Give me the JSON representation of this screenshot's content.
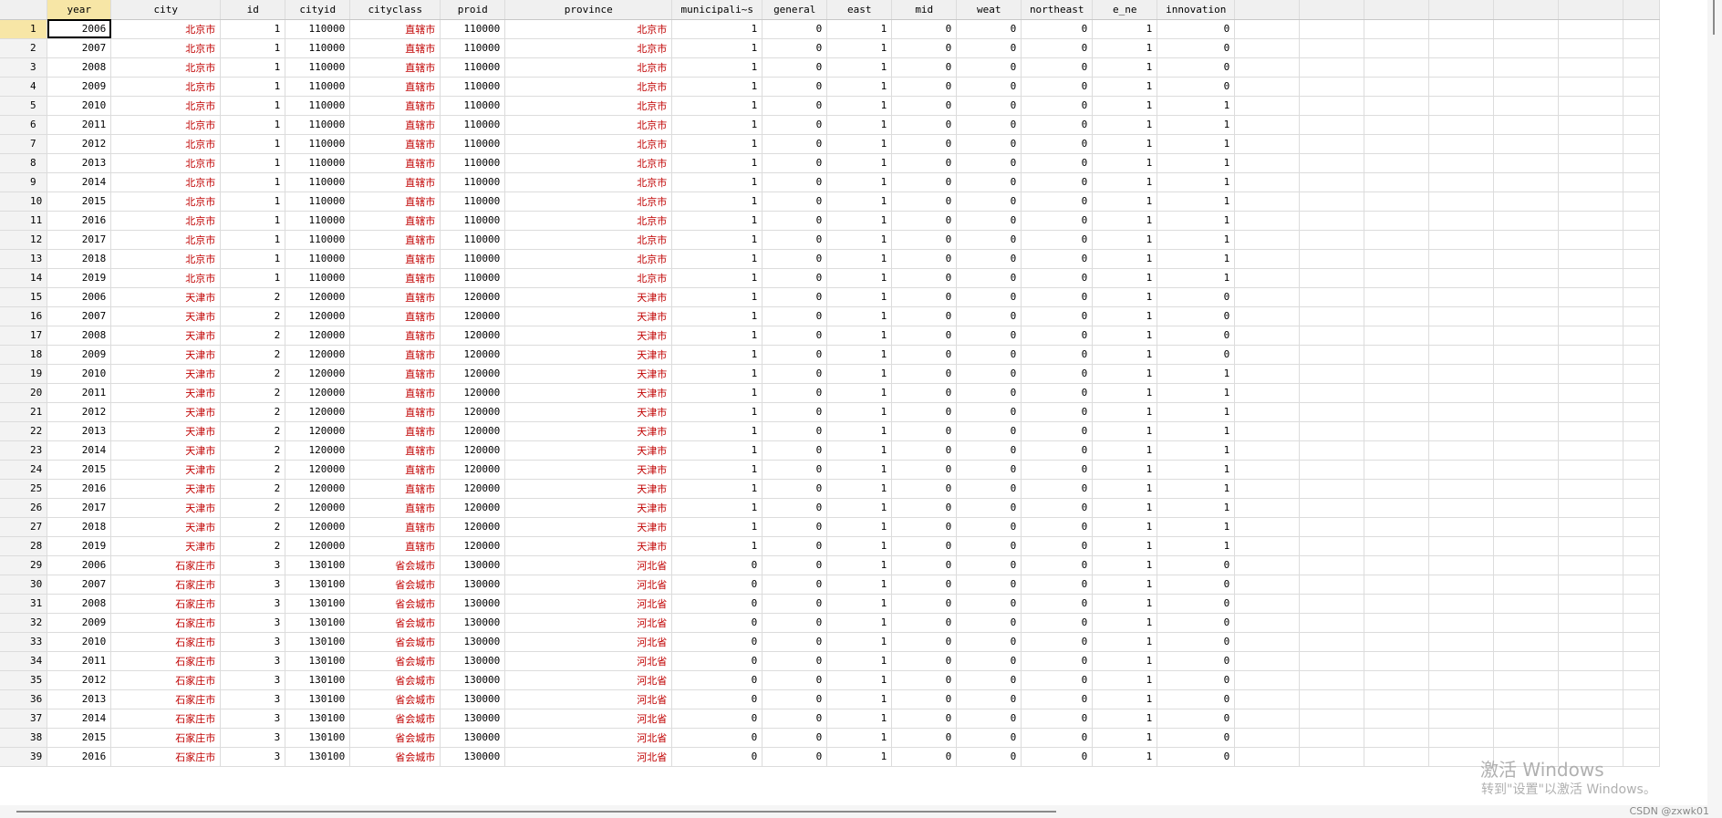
{
  "columns": [
    "year",
    "city",
    "id",
    "cityid",
    "cityclass",
    "proid",
    "province",
    "municipali~s",
    "general",
    "east",
    "mid",
    "weat",
    "northeast",
    "e_ne",
    "innovation"
  ],
  "column_types": [
    "num",
    "str",
    "num",
    "num",
    "str",
    "num",
    "str",
    "num",
    "num",
    "num",
    "num",
    "num",
    "num",
    "num",
    "num"
  ],
  "rows": [
    [
      "2006",
      "北京市",
      "1",
      "110000",
      "直辖市",
      "110000",
      "北京市",
      "1",
      "0",
      "1",
      "0",
      "0",
      "0",
      "1",
      "0"
    ],
    [
      "2007",
      "北京市",
      "1",
      "110000",
      "直辖市",
      "110000",
      "北京市",
      "1",
      "0",
      "1",
      "0",
      "0",
      "0",
      "1",
      "0"
    ],
    [
      "2008",
      "北京市",
      "1",
      "110000",
      "直辖市",
      "110000",
      "北京市",
      "1",
      "0",
      "1",
      "0",
      "0",
      "0",
      "1",
      "0"
    ],
    [
      "2009",
      "北京市",
      "1",
      "110000",
      "直辖市",
      "110000",
      "北京市",
      "1",
      "0",
      "1",
      "0",
      "0",
      "0",
      "1",
      "0"
    ],
    [
      "2010",
      "北京市",
      "1",
      "110000",
      "直辖市",
      "110000",
      "北京市",
      "1",
      "0",
      "1",
      "0",
      "0",
      "0",
      "1",
      "1"
    ],
    [
      "2011",
      "北京市",
      "1",
      "110000",
      "直辖市",
      "110000",
      "北京市",
      "1",
      "0",
      "1",
      "0",
      "0",
      "0",
      "1",
      "1"
    ],
    [
      "2012",
      "北京市",
      "1",
      "110000",
      "直辖市",
      "110000",
      "北京市",
      "1",
      "0",
      "1",
      "0",
      "0",
      "0",
      "1",
      "1"
    ],
    [
      "2013",
      "北京市",
      "1",
      "110000",
      "直辖市",
      "110000",
      "北京市",
      "1",
      "0",
      "1",
      "0",
      "0",
      "0",
      "1",
      "1"
    ],
    [
      "2014",
      "北京市",
      "1",
      "110000",
      "直辖市",
      "110000",
      "北京市",
      "1",
      "0",
      "1",
      "0",
      "0",
      "0",
      "1",
      "1"
    ],
    [
      "2015",
      "北京市",
      "1",
      "110000",
      "直辖市",
      "110000",
      "北京市",
      "1",
      "0",
      "1",
      "0",
      "0",
      "0",
      "1",
      "1"
    ],
    [
      "2016",
      "北京市",
      "1",
      "110000",
      "直辖市",
      "110000",
      "北京市",
      "1",
      "0",
      "1",
      "0",
      "0",
      "0",
      "1",
      "1"
    ],
    [
      "2017",
      "北京市",
      "1",
      "110000",
      "直辖市",
      "110000",
      "北京市",
      "1",
      "0",
      "1",
      "0",
      "0",
      "0",
      "1",
      "1"
    ],
    [
      "2018",
      "北京市",
      "1",
      "110000",
      "直辖市",
      "110000",
      "北京市",
      "1",
      "0",
      "1",
      "0",
      "0",
      "0",
      "1",
      "1"
    ],
    [
      "2019",
      "北京市",
      "1",
      "110000",
      "直辖市",
      "110000",
      "北京市",
      "1",
      "0",
      "1",
      "0",
      "0",
      "0",
      "1",
      "1"
    ],
    [
      "2006",
      "天津市",
      "2",
      "120000",
      "直辖市",
      "120000",
      "天津市",
      "1",
      "0",
      "1",
      "0",
      "0",
      "0",
      "1",
      "0"
    ],
    [
      "2007",
      "天津市",
      "2",
      "120000",
      "直辖市",
      "120000",
      "天津市",
      "1",
      "0",
      "1",
      "0",
      "0",
      "0",
      "1",
      "0"
    ],
    [
      "2008",
      "天津市",
      "2",
      "120000",
      "直辖市",
      "120000",
      "天津市",
      "1",
      "0",
      "1",
      "0",
      "0",
      "0",
      "1",
      "0"
    ],
    [
      "2009",
      "天津市",
      "2",
      "120000",
      "直辖市",
      "120000",
      "天津市",
      "1",
      "0",
      "1",
      "0",
      "0",
      "0",
      "1",
      "0"
    ],
    [
      "2010",
      "天津市",
      "2",
      "120000",
      "直辖市",
      "120000",
      "天津市",
      "1",
      "0",
      "1",
      "0",
      "0",
      "0",
      "1",
      "1"
    ],
    [
      "2011",
      "天津市",
      "2",
      "120000",
      "直辖市",
      "120000",
      "天津市",
      "1",
      "0",
      "1",
      "0",
      "0",
      "0",
      "1",
      "1"
    ],
    [
      "2012",
      "天津市",
      "2",
      "120000",
      "直辖市",
      "120000",
      "天津市",
      "1",
      "0",
      "1",
      "0",
      "0",
      "0",
      "1",
      "1"
    ],
    [
      "2013",
      "天津市",
      "2",
      "120000",
      "直辖市",
      "120000",
      "天津市",
      "1",
      "0",
      "1",
      "0",
      "0",
      "0",
      "1",
      "1"
    ],
    [
      "2014",
      "天津市",
      "2",
      "120000",
      "直辖市",
      "120000",
      "天津市",
      "1",
      "0",
      "1",
      "0",
      "0",
      "0",
      "1",
      "1"
    ],
    [
      "2015",
      "天津市",
      "2",
      "120000",
      "直辖市",
      "120000",
      "天津市",
      "1",
      "0",
      "1",
      "0",
      "0",
      "0",
      "1",
      "1"
    ],
    [
      "2016",
      "天津市",
      "2",
      "120000",
      "直辖市",
      "120000",
      "天津市",
      "1",
      "0",
      "1",
      "0",
      "0",
      "0",
      "1",
      "1"
    ],
    [
      "2017",
      "天津市",
      "2",
      "120000",
      "直辖市",
      "120000",
      "天津市",
      "1",
      "0",
      "1",
      "0",
      "0",
      "0",
      "1",
      "1"
    ],
    [
      "2018",
      "天津市",
      "2",
      "120000",
      "直辖市",
      "120000",
      "天津市",
      "1",
      "0",
      "1",
      "0",
      "0",
      "0",
      "1",
      "1"
    ],
    [
      "2019",
      "天津市",
      "2",
      "120000",
      "直辖市",
      "120000",
      "天津市",
      "1",
      "0",
      "1",
      "0",
      "0",
      "0",
      "1",
      "1"
    ],
    [
      "2006",
      "石家庄市",
      "3",
      "130100",
      "省会城市",
      "130000",
      "河北省",
      "0",
      "0",
      "1",
      "0",
      "0",
      "0",
      "1",
      "0"
    ],
    [
      "2007",
      "石家庄市",
      "3",
      "130100",
      "省会城市",
      "130000",
      "河北省",
      "0",
      "0",
      "1",
      "0",
      "0",
      "0",
      "1",
      "0"
    ],
    [
      "2008",
      "石家庄市",
      "3",
      "130100",
      "省会城市",
      "130000",
      "河北省",
      "0",
      "0",
      "1",
      "0",
      "0",
      "0",
      "1",
      "0"
    ],
    [
      "2009",
      "石家庄市",
      "3",
      "130100",
      "省会城市",
      "130000",
      "河北省",
      "0",
      "0",
      "1",
      "0",
      "0",
      "0",
      "1",
      "0"
    ],
    [
      "2010",
      "石家庄市",
      "3",
      "130100",
      "省会城市",
      "130000",
      "河北省",
      "0",
      "0",
      "1",
      "0",
      "0",
      "0",
      "1",
      "0"
    ],
    [
      "2011",
      "石家庄市",
      "3",
      "130100",
      "省会城市",
      "130000",
      "河北省",
      "0",
      "0",
      "1",
      "0",
      "0",
      "0",
      "1",
      "0"
    ],
    [
      "2012",
      "石家庄市",
      "3",
      "130100",
      "省会城市",
      "130000",
      "河北省",
      "0",
      "0",
      "1",
      "0",
      "0",
      "0",
      "1",
      "0"
    ],
    [
      "2013",
      "石家庄市",
      "3",
      "130100",
      "省会城市",
      "130000",
      "河北省",
      "0",
      "0",
      "1",
      "0",
      "0",
      "0",
      "1",
      "0"
    ],
    [
      "2014",
      "石家庄市",
      "3",
      "130100",
      "省会城市",
      "130000",
      "河北省",
      "0",
      "0",
      "1",
      "0",
      "0",
      "0",
      "1",
      "0"
    ],
    [
      "2015",
      "石家庄市",
      "3",
      "130100",
      "省会城市",
      "130000",
      "河北省",
      "0",
      "0",
      "1",
      "0",
      "0",
      "0",
      "1",
      "0"
    ],
    [
      "2016",
      "石家庄市",
      "3",
      "130100",
      "省会城市",
      "130000",
      "河北省",
      "0",
      "0",
      "1",
      "0",
      "0",
      "0",
      "1",
      "0"
    ]
  ],
  "selection": {
    "row": 1,
    "column": "year"
  },
  "watermark": {
    "line1": "激活 Windows",
    "line2": "转到\"设置\"以激活 Windows。"
  },
  "credit": "CSDN @zxwk01",
  "colors": {
    "string_text": "#c00000",
    "selected_header": "#f7e6a6",
    "grid": "#dcdcdc"
  }
}
